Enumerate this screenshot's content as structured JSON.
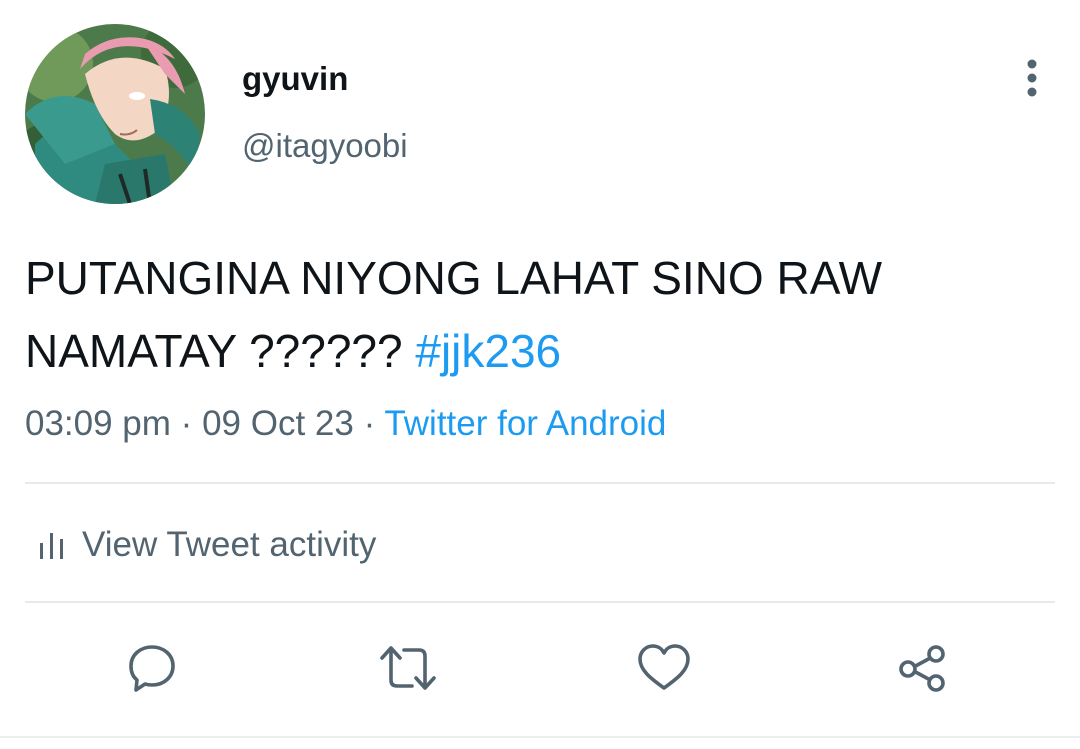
{
  "author": {
    "display_name": "gyuvin",
    "handle": "@itagyoobi"
  },
  "tweet": {
    "text": "PUTANGINA NIYONG LAHAT SINO RAW NAMATAY ??????",
    "hashtag": "#jjk236"
  },
  "meta": {
    "time": "03:09 pm",
    "separator": "·",
    "date": "09 Oct 23",
    "source": "Twitter for Android"
  },
  "activity": {
    "label": "View Tweet activity"
  },
  "actions": {
    "icons": [
      "reply-icon",
      "retweet-icon",
      "like-icon",
      "share-icon"
    ]
  },
  "colors": {
    "text": "#0f1419",
    "secondary": "#536471",
    "link": "#1d9bf0",
    "divider": "#e7e9eb"
  }
}
